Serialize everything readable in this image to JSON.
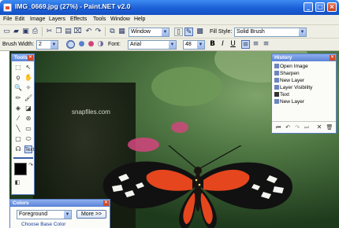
{
  "window": {
    "title": "IMG_0669.jpg (27%) - Paint.NET v2.0",
    "controls": {
      "minimize": "_",
      "maximize": "□",
      "close": "×"
    }
  },
  "menubar": [
    "File",
    "Edit",
    "Image",
    "Layers",
    "Effects",
    "Tools",
    "Window",
    "Help"
  ],
  "toolbar": {
    "window_select": "Window",
    "fill_style_label": "Fill Style:",
    "fill_style_value": "Solid Brush",
    "brush_width_label": "Brush Width:",
    "brush_width_value": "2",
    "font_label": "Font:",
    "font_value": "Arial",
    "font_size_value": "48",
    "bold": "B",
    "italic": "I",
    "underline": "U"
  },
  "canvas": {
    "watermark": "snapfiles.com"
  },
  "tools_panel": {
    "title": "Tools",
    "close": "×",
    "text_tool_label": "Text"
  },
  "history_panel": {
    "title": "History",
    "close": "×",
    "items": [
      "Open Image",
      "Sharpen",
      "New Layer",
      "Layer Visibility",
      "Text",
      "New Layer"
    ]
  },
  "colors_panel": {
    "title": "Colors",
    "close": "×",
    "mode_select": "Foreground",
    "more_button": "More >>",
    "choose_base": "Choose Base Color"
  },
  "icons": [
    "new-icon",
    "open-icon",
    "save-icon",
    "print-icon",
    "cut-icon",
    "copy-icon",
    "paste-icon",
    "undo-icon",
    "redo-icon",
    "crop-icon",
    "rulers-icon",
    "brush-icon",
    "antialias-icon"
  ],
  "colors": {
    "titlebar": "#1c5fd6",
    "panel_header": "#5a83d6",
    "primary_color": "#000000",
    "secondary_color": "#ffffff"
  }
}
